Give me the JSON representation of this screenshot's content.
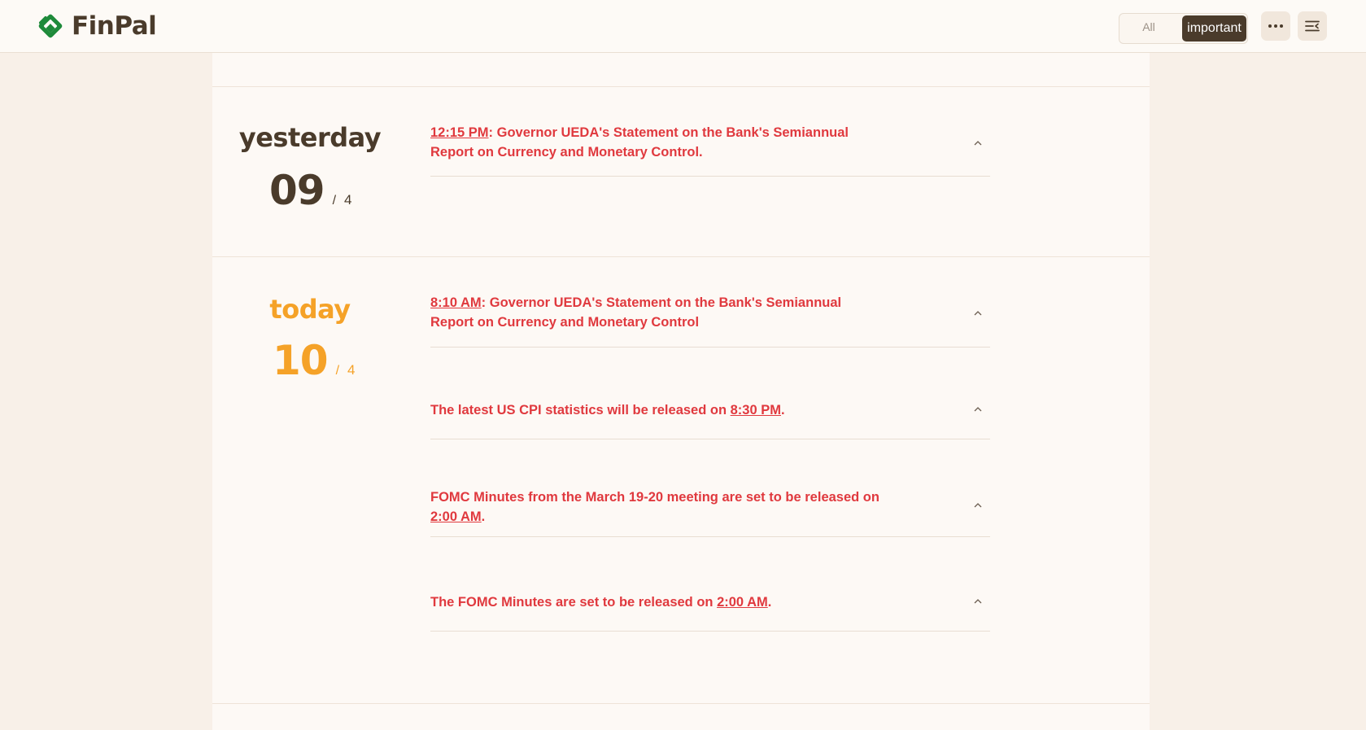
{
  "header": {
    "brand": "FinPal",
    "filter": {
      "all_label": "All",
      "important_label": "important",
      "selected": "important"
    },
    "icons": {
      "more": "more-horizontal-icon",
      "menu": "menu-collapse-icon"
    }
  },
  "colors": {
    "brand_dark": "#4a3b2b",
    "accent_today": "#f5a228",
    "important_event": "#e0393e",
    "logo_green": "#1e8a3a"
  },
  "days": [
    {
      "label": "yesterday",
      "day": "09",
      "sep": "/",
      "month": "4",
      "events": [
        {
          "time": "12:15 PM",
          "before": "",
          "after": ": Governor UEDA's Statement on the Bank's Semiannual Report on Currency and Monetary Control."
        }
      ]
    },
    {
      "label": "today",
      "day": "10",
      "sep": "/",
      "month": "4",
      "events": [
        {
          "time": "8:10 AM",
          "before": "",
          "after": ": Governor UEDA's Statement on the Bank's Semiannual Report on Currency and Monetary Control"
        },
        {
          "time": "8:30 PM",
          "before": "The latest US CPI statistics will be released on ",
          "after": "."
        },
        {
          "time": "2:00 AM",
          "before": "FOMC Minutes from the March 19-20 meeting are set to be released on ",
          "after": "."
        },
        {
          "time": "2:00 AM",
          "before": "The FOMC Minutes are set to be released on ",
          "after": "."
        }
      ]
    }
  ]
}
